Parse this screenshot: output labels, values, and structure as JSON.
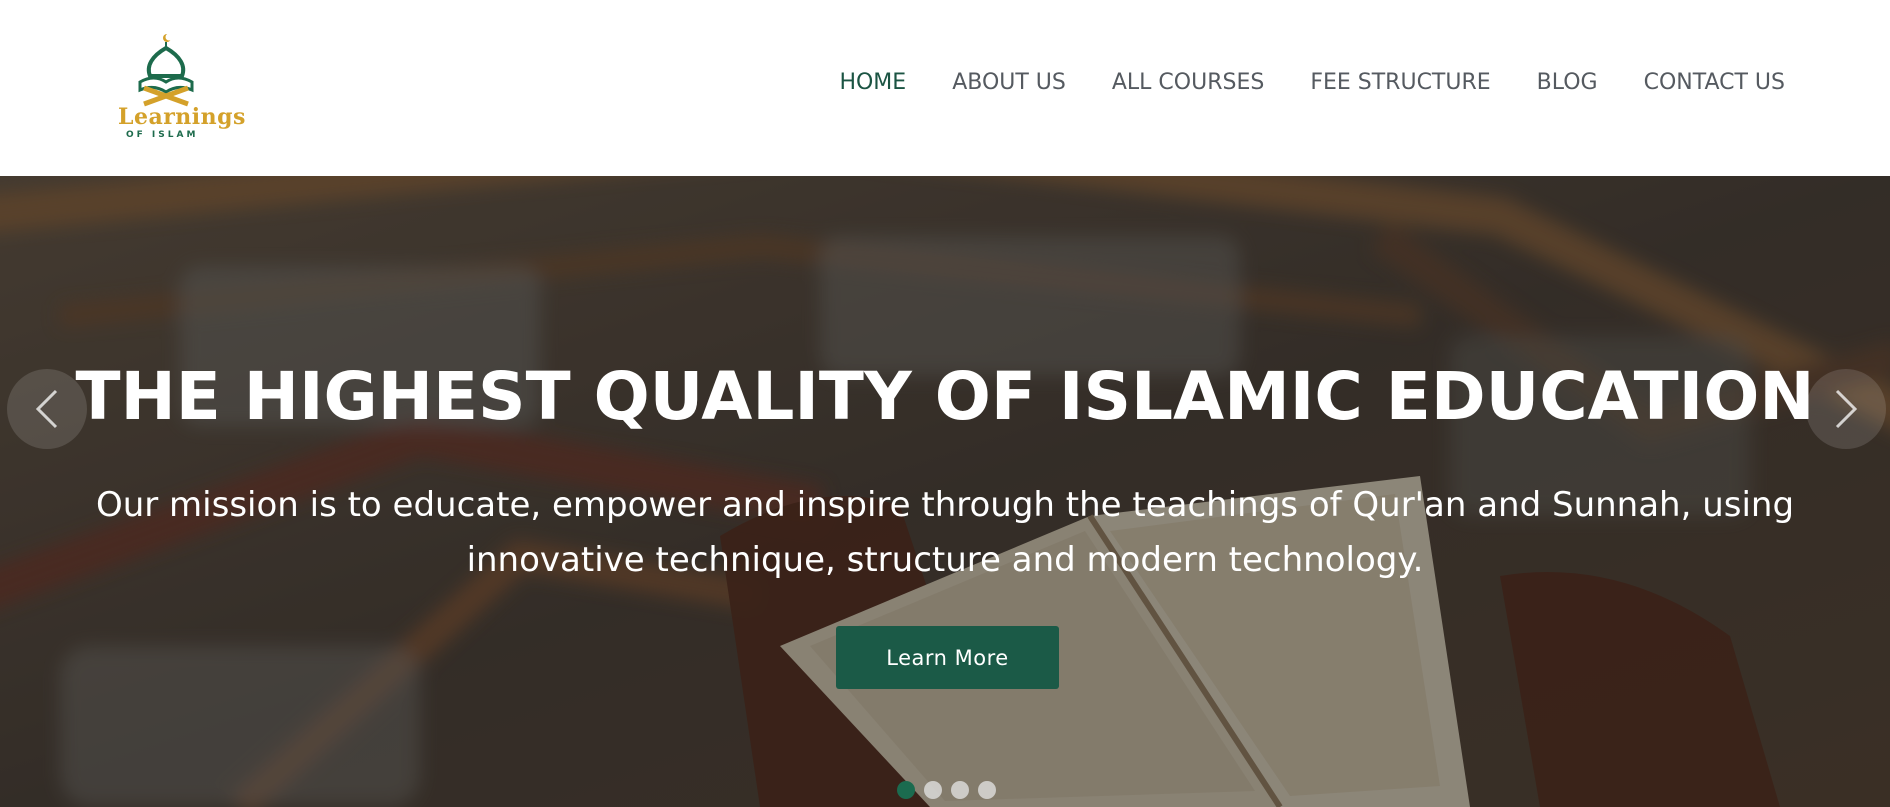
{
  "brand": {
    "logo_word": "Learnings",
    "logo_sub": "OF ISLAM",
    "primary_color": "#1b5a47",
    "gold_color": "#d4a12a"
  },
  "nav": {
    "items": [
      {
        "label": "HOME",
        "active": true
      },
      {
        "label": "ABOUT US",
        "active": false
      },
      {
        "label": "ALL COURSES",
        "active": false
      },
      {
        "label": "FEE STRUCTURE",
        "active": false
      },
      {
        "label": "BLOG",
        "active": false
      },
      {
        "label": "CONTACT US",
        "active": false
      }
    ]
  },
  "hero": {
    "title": "THE HIGHEST QUALITY OF ISLAMIC EDUCATION",
    "subtitle_line1": "Our mission is to educate, empower and inspire through the teachings of Qur'an and Sunnah, using",
    "subtitle_line2": "innovative technique, structure and modern technology.",
    "cta_label": "Learn More",
    "prev_icon": "chevron-left-icon",
    "next_icon": "chevron-right-icon",
    "slide_count": 4,
    "active_slide": 1
  }
}
